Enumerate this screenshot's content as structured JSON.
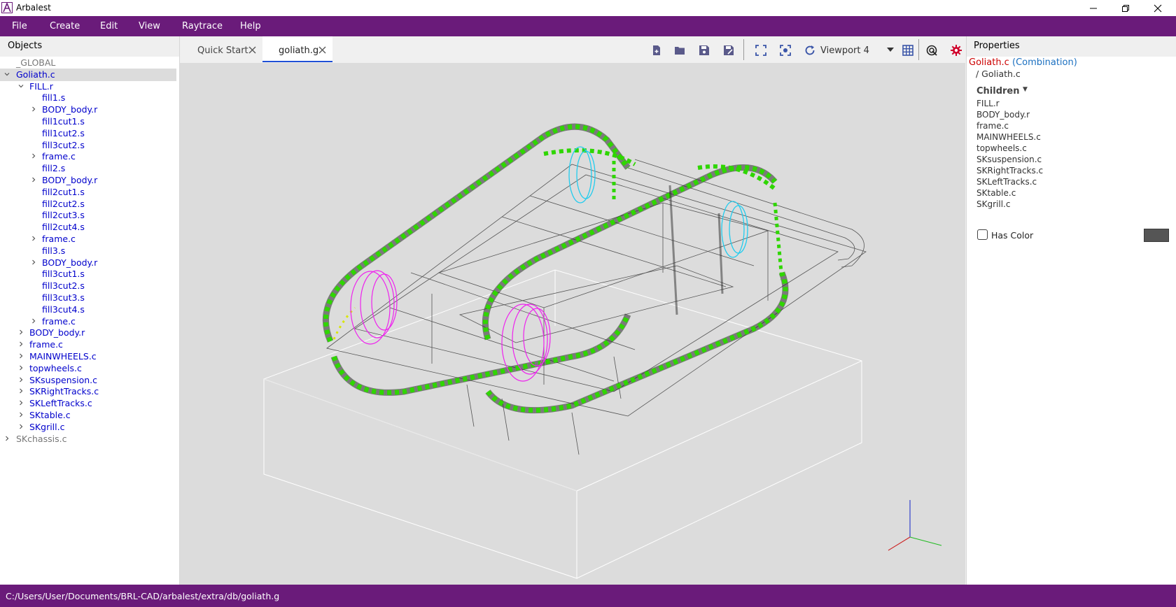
{
  "window": {
    "title": "Arbalest"
  },
  "menu": {
    "items": [
      "File",
      "Create",
      "Edit",
      "View",
      "Raytrace",
      "Help"
    ]
  },
  "objects_panel": {
    "title": "Objects",
    "tree": [
      {
        "label": "_GLOBAL",
        "depth": 0,
        "expander": "none",
        "state": "grey"
      },
      {
        "label": "Goliath.c",
        "depth": 0,
        "expander": "expanded",
        "state": "selected"
      },
      {
        "label": "FILL.r",
        "depth": 1,
        "expander": "expanded"
      },
      {
        "label": "fill1.s",
        "depth": 2,
        "expander": "none"
      },
      {
        "label": "BODY_body.r",
        "depth": 2,
        "expander": "collapsed"
      },
      {
        "label": "fill1cut1.s",
        "depth": 2,
        "expander": "none"
      },
      {
        "label": "fill1cut2.s",
        "depth": 2,
        "expander": "none"
      },
      {
        "label": "fill3cut2.s",
        "depth": 2,
        "expander": "none"
      },
      {
        "label": "frame.c",
        "depth": 2,
        "expander": "collapsed"
      },
      {
        "label": "fill2.s",
        "depth": 2,
        "expander": "none"
      },
      {
        "label": "BODY_body.r",
        "depth": 2,
        "expander": "collapsed"
      },
      {
        "label": "fill2cut1.s",
        "depth": 2,
        "expander": "none"
      },
      {
        "label": "fill2cut2.s",
        "depth": 2,
        "expander": "none"
      },
      {
        "label": "fill2cut3.s",
        "depth": 2,
        "expander": "none"
      },
      {
        "label": "fill2cut4.s",
        "depth": 2,
        "expander": "none"
      },
      {
        "label": "frame.c",
        "depth": 2,
        "expander": "collapsed"
      },
      {
        "label": "fill3.s",
        "depth": 2,
        "expander": "none"
      },
      {
        "label": "BODY_body.r",
        "depth": 2,
        "expander": "collapsed"
      },
      {
        "label": "fill3cut1.s",
        "depth": 2,
        "expander": "none"
      },
      {
        "label": "fill3cut2.s",
        "depth": 2,
        "expander": "none"
      },
      {
        "label": "fill3cut3.s",
        "depth": 2,
        "expander": "none"
      },
      {
        "label": "fill3cut4.s",
        "depth": 2,
        "expander": "none"
      },
      {
        "label": "frame.c",
        "depth": 2,
        "expander": "collapsed"
      },
      {
        "label": "BODY_body.r",
        "depth": 1,
        "expander": "collapsed"
      },
      {
        "label": "frame.c",
        "depth": 1,
        "expander": "collapsed"
      },
      {
        "label": "MAINWHEELS.c",
        "depth": 1,
        "expander": "collapsed"
      },
      {
        "label": "topwheels.c",
        "depth": 1,
        "expander": "collapsed"
      },
      {
        "label": "SKsuspension.c",
        "depth": 1,
        "expander": "collapsed"
      },
      {
        "label": "SKRightTracks.c",
        "depth": 1,
        "expander": "collapsed"
      },
      {
        "label": "SKLeftTracks.c",
        "depth": 1,
        "expander": "collapsed"
      },
      {
        "label": "SKtable.c",
        "depth": 1,
        "expander": "collapsed"
      },
      {
        "label": "SKgrill.c",
        "depth": 1,
        "expander": "collapsed"
      },
      {
        "label": "SKchassis.c",
        "depth": 0,
        "expander": "collapsed",
        "state": "grey"
      }
    ]
  },
  "tabs": [
    {
      "label": "Quick Start",
      "active": false
    },
    {
      "label": "goliath.g",
      "active": true
    }
  ],
  "toolbar": {
    "icons": [
      "new-file-icon",
      "open-folder-icon",
      "save-icon",
      "save-as-icon",
      "fit-view-icon",
      "focus-selection-icon",
      "reset-view-icon",
      "grid-icon",
      "raytrace-icon",
      "settings-gear-icon"
    ],
    "viewport_selected": "Viewport 4",
    "accent_color": "#1f4fd6"
  },
  "properties": {
    "title": "Properties",
    "object_name": "Goliath.c",
    "object_type_open": "(",
    "object_type": "Combination",
    "object_type_close": ")",
    "object_path": "/ Goliath.c",
    "children_label": "Children",
    "children": [
      "FILL.r",
      "BODY_body.r",
      "frame.c",
      "MAINWHEELS.c",
      "topwheels.c",
      "SKsuspension.c",
      "SKRightTracks.c",
      "SKLeftTracks.c",
      "SKtable.c",
      "SKgrill.c"
    ],
    "has_color_label": "Has Color",
    "has_color_checked": false,
    "color_value": "#555555"
  },
  "status_bar": {
    "path": "C:/Users/User/Documents/BRL-CAD/arbalest/extra/db/goliath.g"
  },
  "colors": {
    "brand_purple": "#6a1b7a",
    "object_link": "#0000cc",
    "selected_object_red": "#cc0000",
    "type_link_blue": "#1a6fc0"
  }
}
